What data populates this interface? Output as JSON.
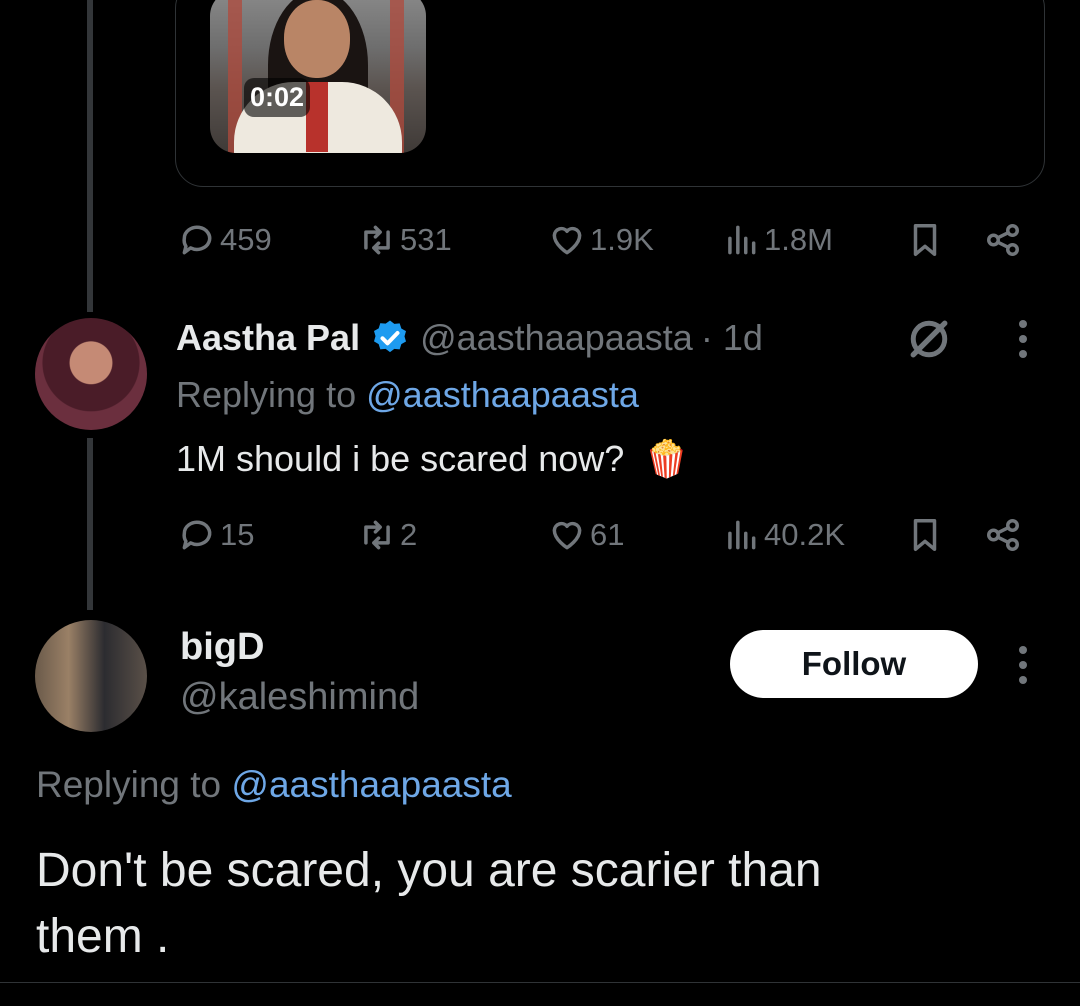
{
  "quoted_video": {
    "duration": "0:02"
  },
  "main_tweet": {
    "stats": {
      "replies": "459",
      "reposts": "531",
      "likes": "1.9K",
      "views": "1.8M"
    }
  },
  "reply1": {
    "name": "Aastha Pal",
    "handle": "@aasthaapaasta",
    "time": "· 1d",
    "replying_label": "Replying to",
    "replying_handle": "@aasthaapaasta",
    "text": "1M should i be scared now?",
    "emoji": "🍿",
    "stats": {
      "replies": "15",
      "reposts": "2",
      "likes": "61",
      "views": "40.2K"
    }
  },
  "reply2": {
    "name": "bigD",
    "handle": "@kaleshimind",
    "follow_label": "Follow",
    "replying_label": "Replying to",
    "replying_handle": "@aasthaapaasta",
    "text_line1": "Don't be scared, you are scarier than",
    "text_line2": "them ."
  },
  "colors": {
    "background": "#000000",
    "text": "#e7e9ea",
    "muted": "#71767b",
    "link": "#6ea7e6",
    "verified": "#1d9bf0"
  },
  "icons": [
    "reply-icon",
    "repost-icon",
    "like-icon",
    "views-icon",
    "bookmark-icon",
    "share-icon",
    "grok-icon",
    "more-icon",
    "verified-icon"
  ]
}
